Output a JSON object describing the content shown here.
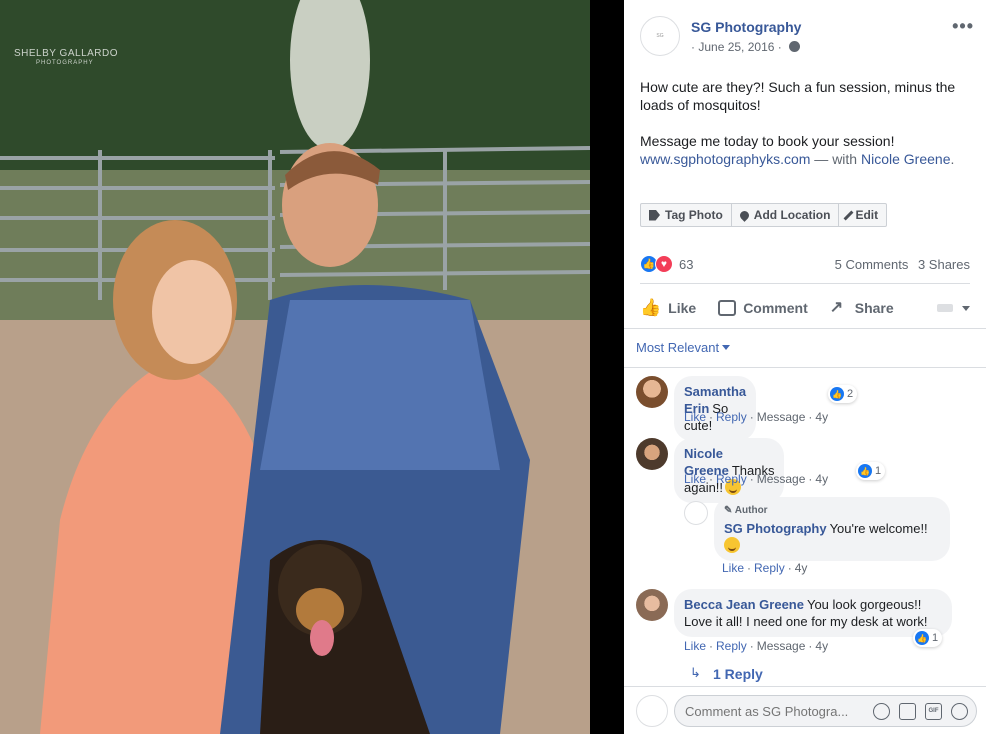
{
  "photo": {
    "watermark_name": "SHELBY GALLARDO",
    "watermark_sub": "PHOTOGRAPHY"
  },
  "post": {
    "page_name": "SG Photography",
    "date": "June 25, 2016",
    "text_line1": "How cute are they?! Such a fun session, minus the loads of mosquitos!",
    "text_line2": "Message me today to book your session!",
    "url": "www.sgphotographyks.com",
    "with_text": " — with ",
    "tagged_person": "Nicole Greene",
    "period": ".",
    "tag_photo": "Tag Photo",
    "add_location": "Add Location",
    "edit": "Edit",
    "reaction_count": "63",
    "comments_count": "5 Comments",
    "shares_count": "3 Shares",
    "like": "Like",
    "comment": "Comment",
    "share": "Share"
  },
  "comments_sort": "Most Relevant",
  "comments": [
    {
      "name": "Samantha Erin",
      "text": "So cute!",
      "reacts": "2",
      "like": "Like",
      "reply": "Reply",
      "message": "Message",
      "age": "4y"
    },
    {
      "name": "Nicole Greene",
      "text": "Thanks again!!",
      "reacts": "1",
      "like": "Like",
      "reply": "Reply",
      "message": "Message",
      "age": "4y"
    },
    {
      "badge": "Author",
      "name": "SG Photography",
      "text": "You're welcome!!",
      "like": "Like",
      "reply": "Reply",
      "age": "4y"
    },
    {
      "name": "Becca Jean Greene",
      "text": "You look gorgeous!! Love it all! I need one for my desk at work!",
      "reacts": "1",
      "like": "Like",
      "reply": "Reply",
      "message": "Message",
      "age": "4y"
    }
  ],
  "replies_link": "1 Reply",
  "composer": {
    "placeholder": "Comment as SG Photogra..."
  },
  "colors": {
    "link": "#385898",
    "accent": "#4267b2",
    "like_blue": "#1877f2",
    "love_red": "#f33e58"
  },
  "icons": [
    "globe-icon",
    "more-icon",
    "tag-icon",
    "location-pin-icon",
    "pencil-icon",
    "like-icon",
    "comment-icon",
    "share-icon",
    "emoji-icon",
    "camera-icon",
    "gif-icon",
    "sticker-icon",
    "reply-arrow-icon"
  ]
}
